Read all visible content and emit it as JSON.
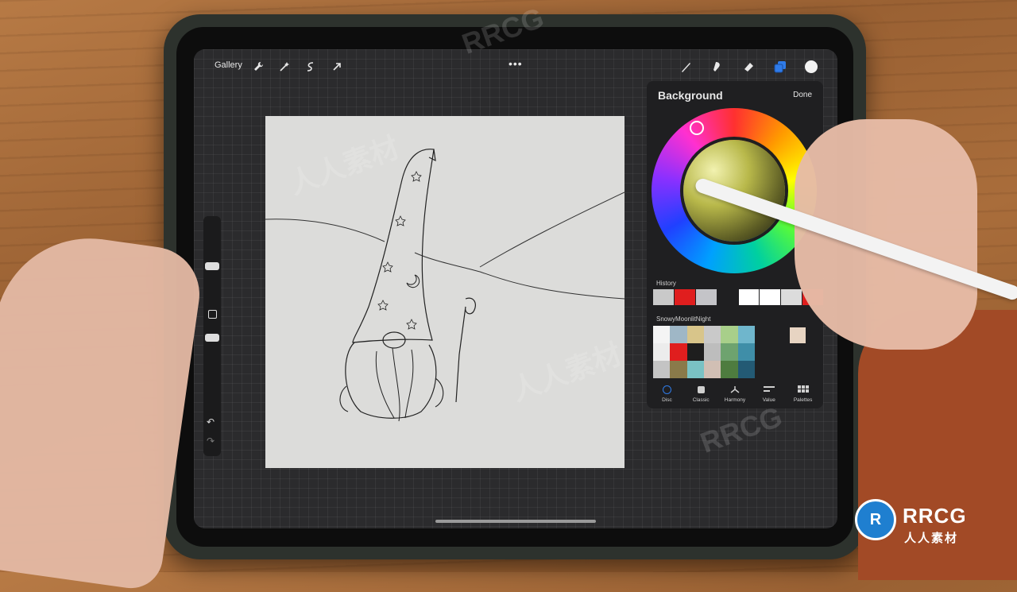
{
  "app": {
    "gallery_label": "Gallery",
    "more_label": "•••"
  },
  "toolbar": {
    "left_tools": [
      "wrench-icon",
      "magic-wand-icon",
      "selection-icon",
      "transform-arrow-icon"
    ],
    "right_tools": [
      "brush-icon",
      "smudge-icon",
      "eraser-icon",
      "layers-icon"
    ],
    "current_color": "#f2f2f2"
  },
  "color_panel": {
    "title": "Background",
    "done_label": "Done",
    "history_label": "History",
    "history_colors": [
      "#c9c9c9",
      "#e01e1e",
      "#c4c4c8",
      "#1f1f21",
      "#ffffff",
      "#ffffff",
      "#dcdcdc",
      "#e01e1e"
    ],
    "palette_name": "SnowyMoonlitNight",
    "palette_colors": [
      "#f4f4f4",
      "#9fb7c6",
      "#d8c58a",
      "#c9c9c9",
      "#a8cf8a",
      "#6fb6cc",
      "#ececec",
      "#e01e1e",
      "#1e1e1e",
      "#bdbdbd",
      "#6ea36f",
      "#3f8ea8",
      "#c4c4c4",
      "#8a7a4a",
      "#7ac2c4",
      "#d1bfb4",
      "#4e7c3f",
      "#235a74"
    ],
    "selected_swatch": "#e7d4c2",
    "tabs": [
      {
        "label": "Disc",
        "icon": "disc-icon"
      },
      {
        "label": "Classic",
        "icon": "classic-icon"
      },
      {
        "label": "Harmony",
        "icon": "harmony-icon"
      },
      {
        "label": "Value",
        "icon": "value-icon"
      },
      {
        "label": "Palettes",
        "icon": "palettes-icon"
      }
    ],
    "active_tab": "Disc"
  },
  "watermark": {
    "brand": "RRCG",
    "sub": "人人素材"
  }
}
